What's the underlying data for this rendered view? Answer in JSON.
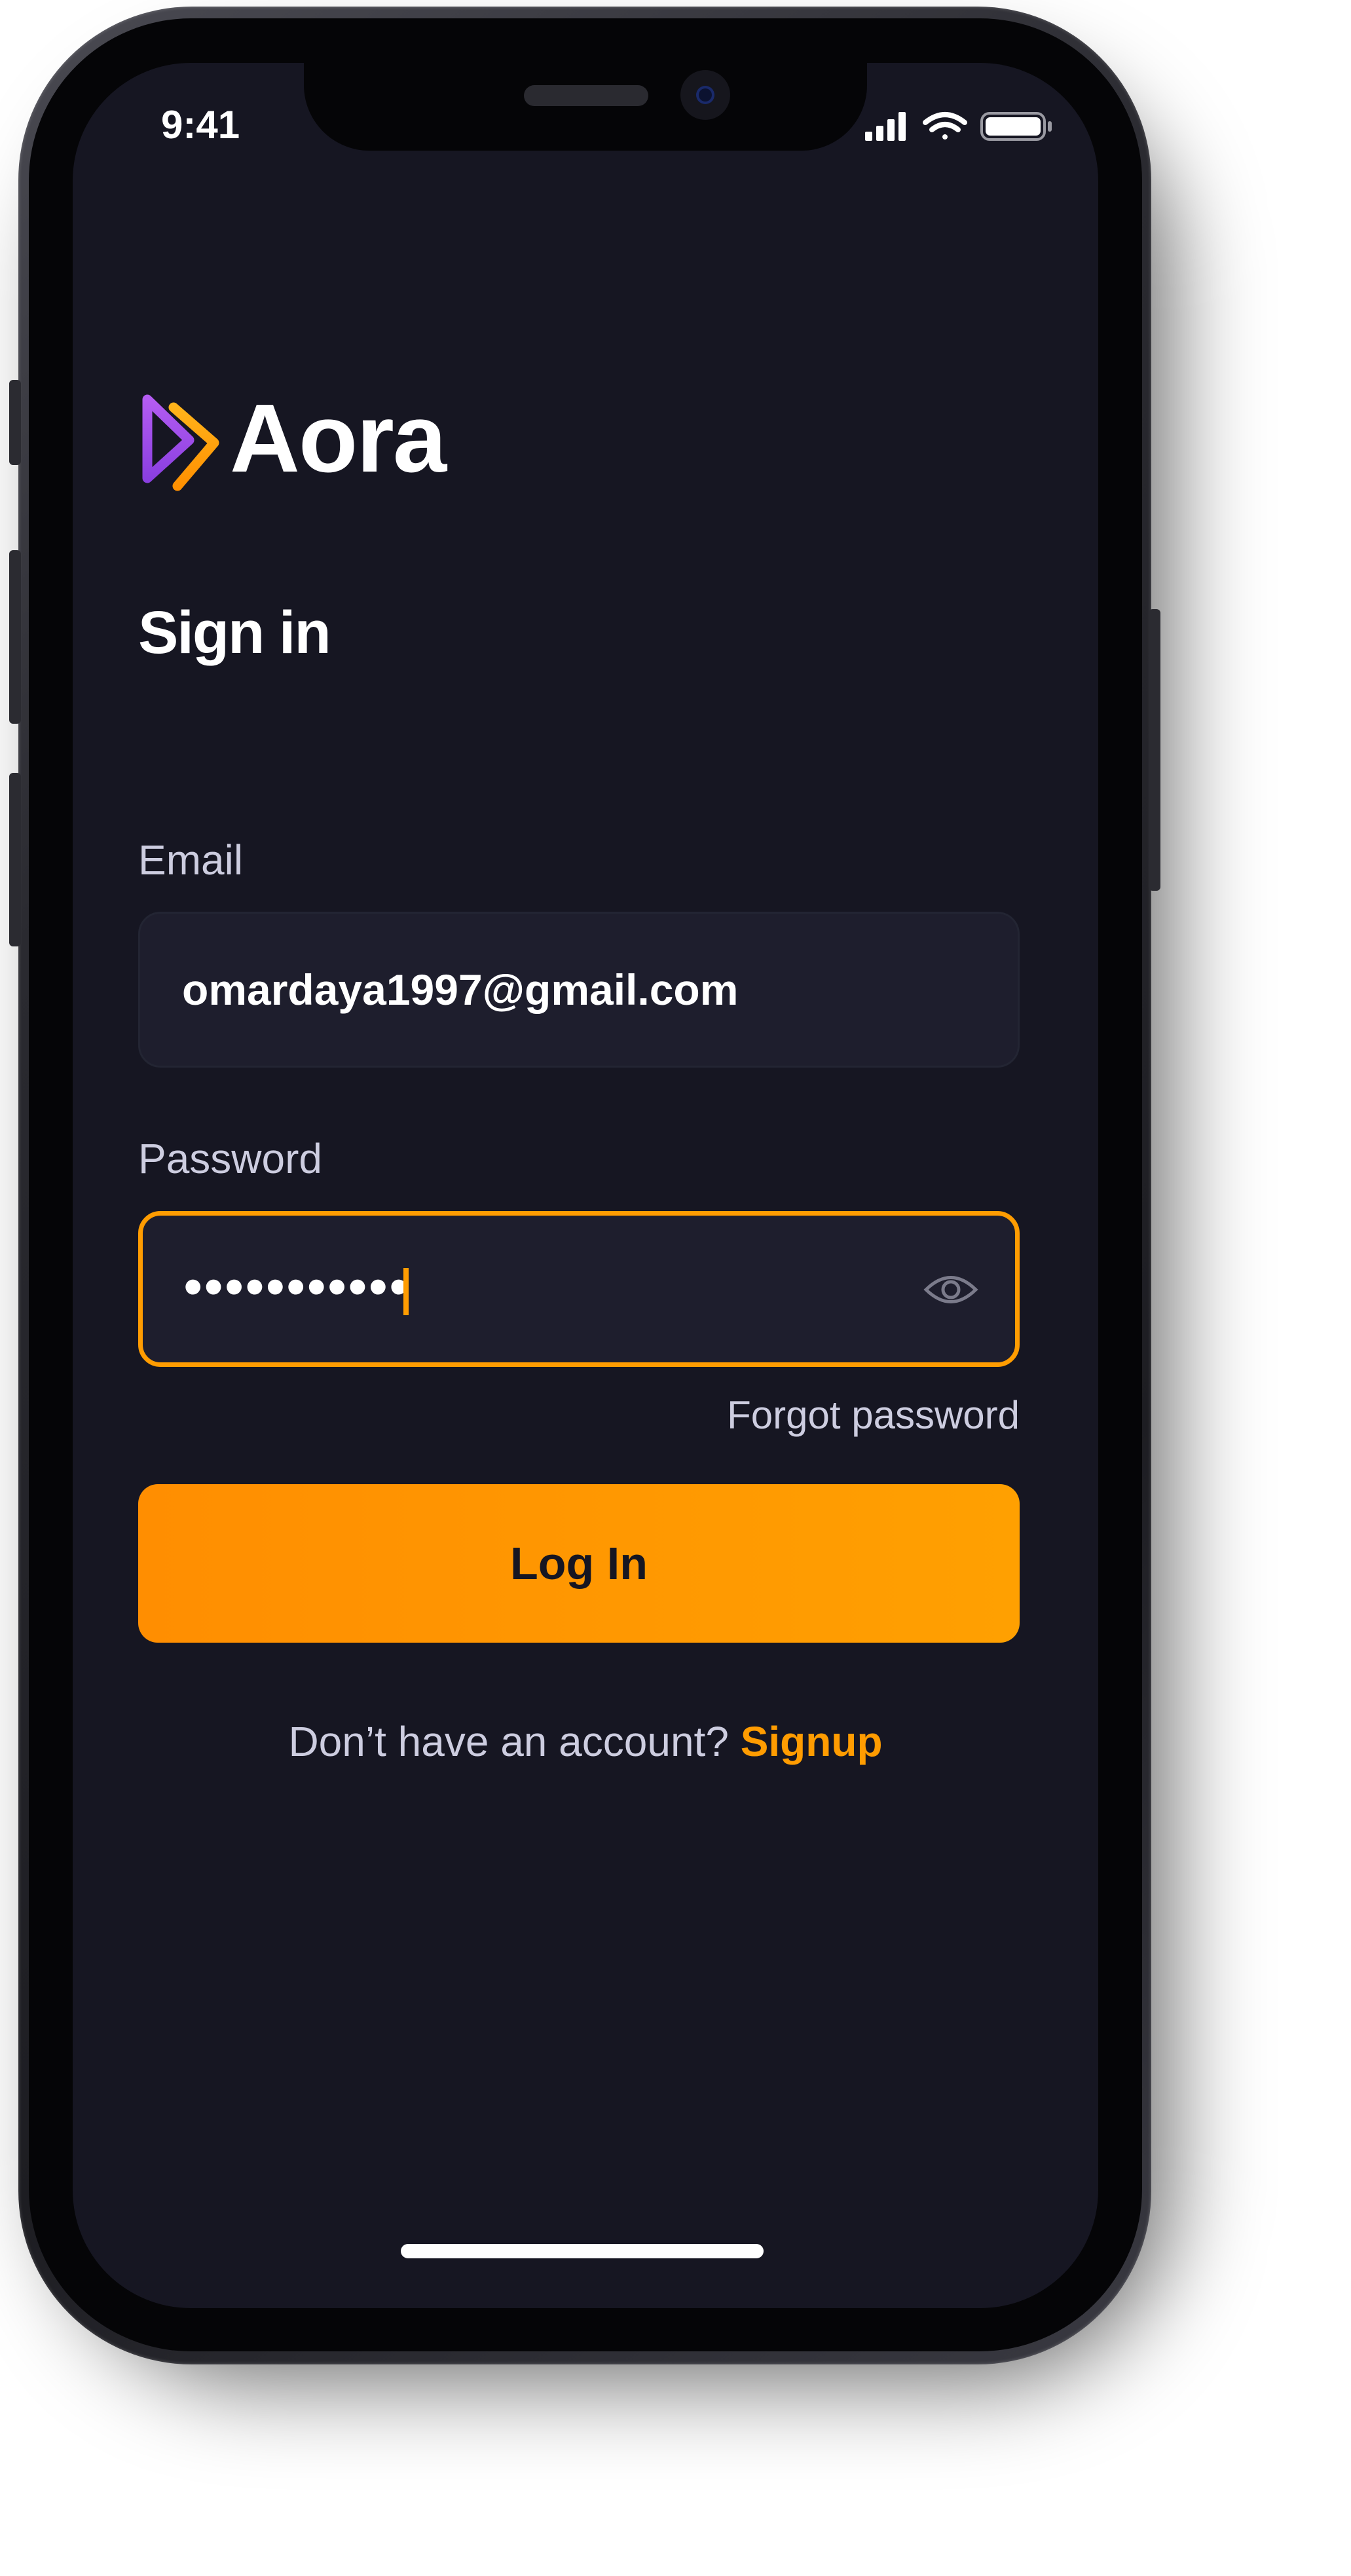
{
  "status_bar": {
    "time": "9:41",
    "icons": [
      "signal-icon",
      "wifi-icon",
      "battery-icon"
    ]
  },
  "brand": {
    "name": "Aora",
    "logo_colors": [
      "#9945FF",
      "#FF9C01"
    ]
  },
  "screen": {
    "title": "Sign in"
  },
  "email": {
    "label": "Email",
    "value": "omardaya1997@gmail.com"
  },
  "password": {
    "label": "Password",
    "value": "•••••••••••",
    "visibility_icon": "eye-icon"
  },
  "forgot_password": "Forgot password",
  "login_button": "Log In",
  "signup_prompt": {
    "text": "Don’t have an account?",
    "link": "Signup"
  },
  "colors": {
    "background": "#161622",
    "field_bg": "#1E1E2D",
    "accent": "#FF9C01",
    "text_muted": "#CDCDE0"
  }
}
